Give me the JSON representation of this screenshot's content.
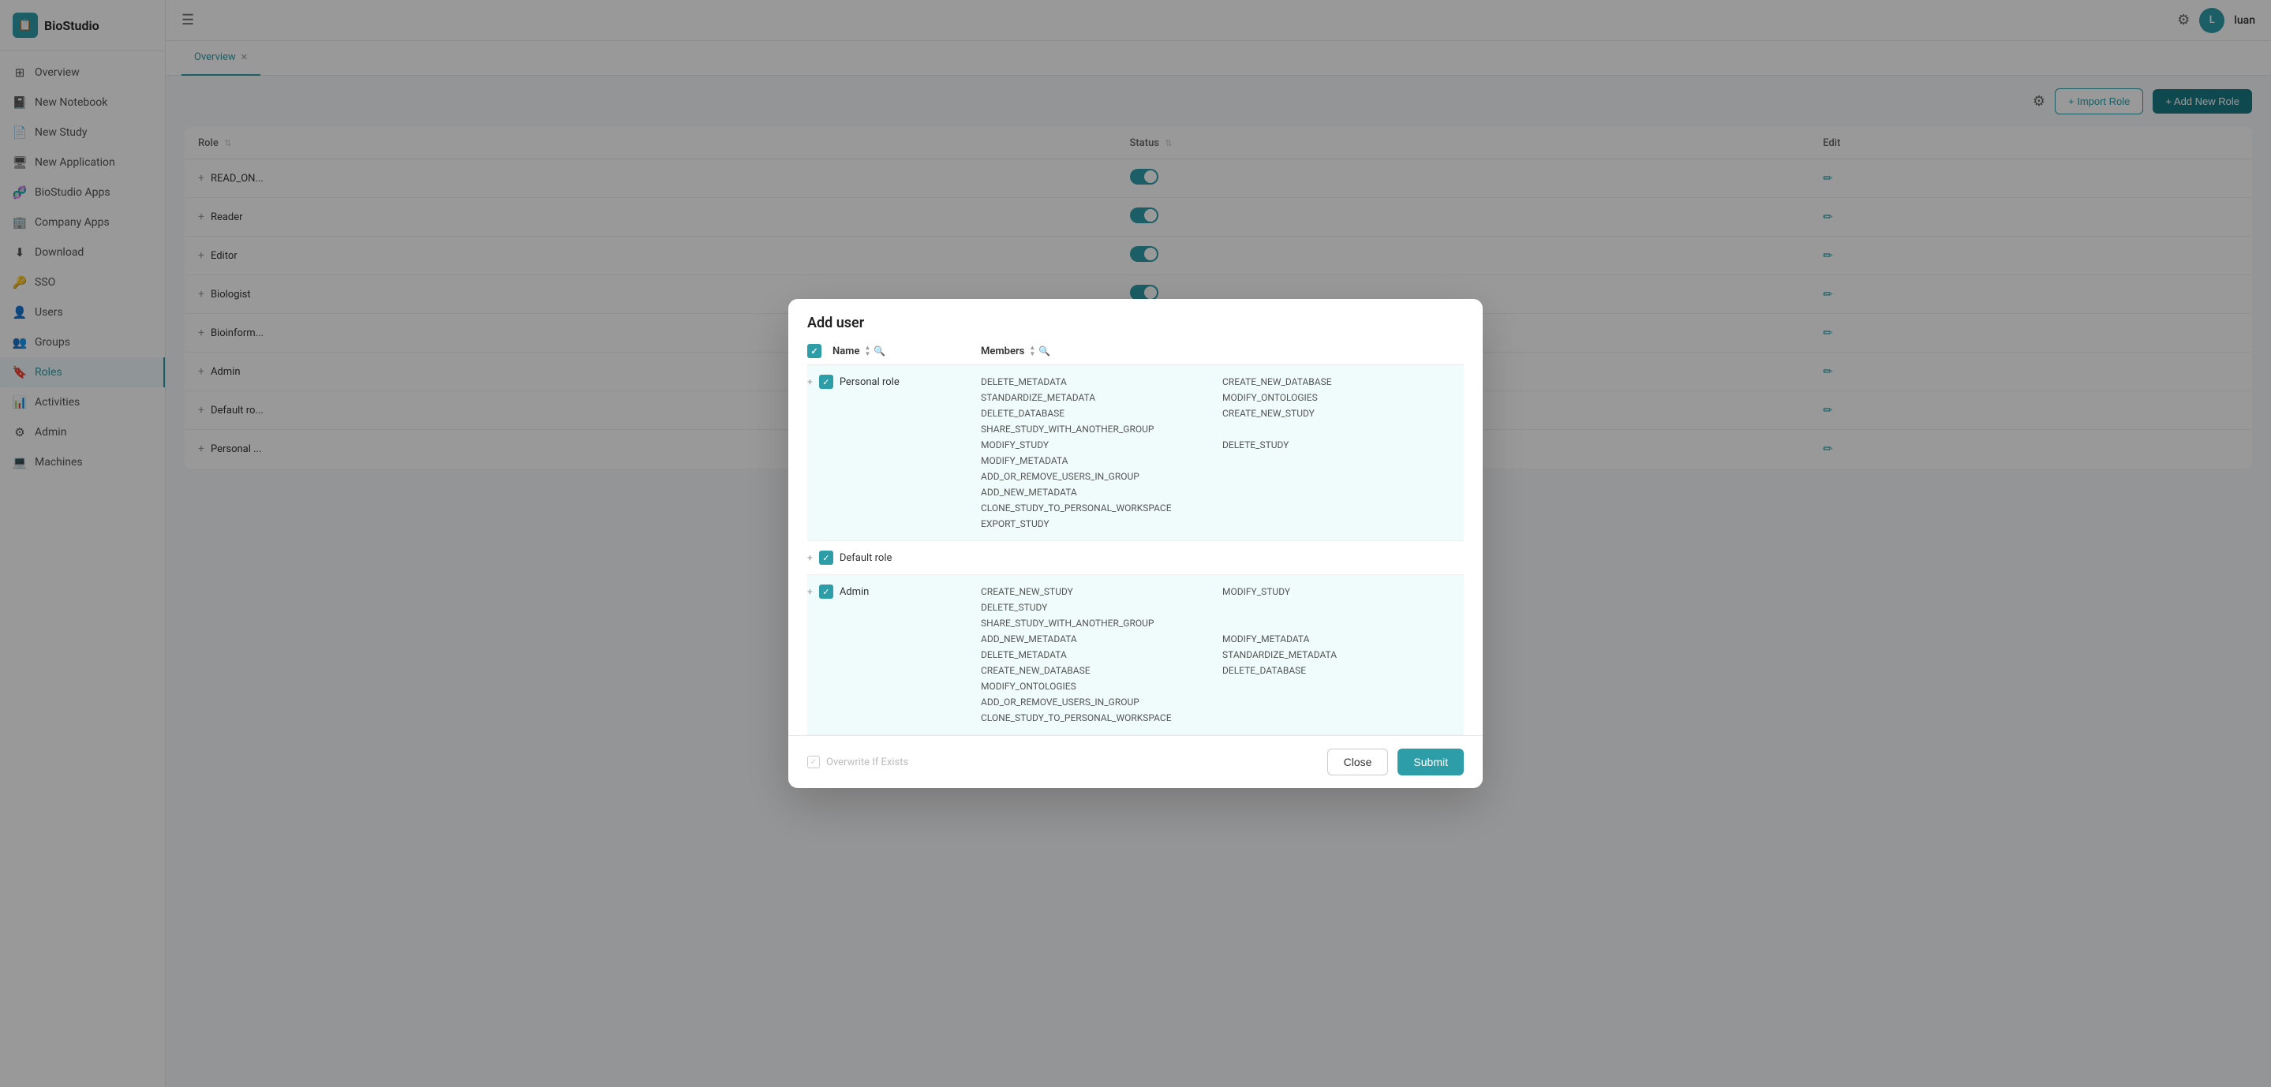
{
  "app": {
    "logo_text": "BioStudio",
    "logo_icon": "📋",
    "user_name": "luan",
    "user_initial": "L"
  },
  "sidebar": {
    "items": [
      {
        "id": "overview",
        "label": "Overview",
        "icon": "⊞",
        "active": false
      },
      {
        "id": "new-notebook",
        "label": "New Notebook",
        "icon": "📓",
        "active": false
      },
      {
        "id": "new-study",
        "label": "New Study",
        "icon": "📄",
        "active": false
      },
      {
        "id": "new-application",
        "label": "New Application",
        "icon": "🖥",
        "active": false
      },
      {
        "id": "biostudio-apps",
        "label": "BioStudio Apps",
        "icon": "🧬",
        "active": false
      },
      {
        "id": "company-apps",
        "label": "Company Apps",
        "icon": "🏢",
        "active": false
      },
      {
        "id": "download",
        "label": "Download",
        "icon": "⬇",
        "active": false
      },
      {
        "id": "sso",
        "label": "SSO",
        "icon": "🔑",
        "active": false
      },
      {
        "id": "users",
        "label": "Users",
        "icon": "👤",
        "active": false
      },
      {
        "id": "groups",
        "label": "Groups",
        "icon": "👥",
        "active": false
      },
      {
        "id": "roles",
        "label": "Roles",
        "icon": "🔖",
        "active": true
      },
      {
        "id": "activities",
        "label": "Activities",
        "icon": "📊",
        "active": false
      },
      {
        "id": "admin",
        "label": "Admin",
        "icon": "⚙",
        "active": false
      },
      {
        "id": "machines",
        "label": "Machines",
        "icon": "💻",
        "active": false
      }
    ]
  },
  "tabs": [
    {
      "id": "overview",
      "label": "Overview",
      "active": true
    }
  ],
  "toolbar": {
    "import_role_label": "+ Import Role",
    "add_new_role_label": "+ Add New Role"
  },
  "table": {
    "columns": [
      {
        "id": "role",
        "label": "Role"
      },
      {
        "id": "status",
        "label": "Status"
      },
      {
        "id": "edit",
        "label": "Edit"
      }
    ],
    "rows": [
      {
        "id": 1,
        "role": "READ_ON...",
        "status": true
      },
      {
        "id": 2,
        "role": "Reader",
        "status": true
      },
      {
        "id": 3,
        "role": "Editor",
        "status": true
      },
      {
        "id": 4,
        "role": "Biologist",
        "status": true
      },
      {
        "id": 5,
        "role": "Bioinform...",
        "status": true
      },
      {
        "id": 6,
        "role": "Admin",
        "status": true
      },
      {
        "id": 7,
        "role": "Default ro...",
        "status": true
      },
      {
        "id": 8,
        "role": "Personal ...",
        "status": true
      }
    ]
  },
  "modal": {
    "title": "Add user",
    "col_name": "Name",
    "col_members": "Members",
    "roles": [
      {
        "id": "personal",
        "label": "Personal role",
        "checked": true,
        "expanded": true,
        "permissions": [
          "DELETE_METADATA",
          "CREATE_NEW_DATABASE",
          "STANDARDIZE_METADATA",
          "MODIFY_ONTOLOGIES",
          "DELETE_DATABASE",
          "CREATE_NEW_STUDY",
          "SHARE_STUDY_WITH_ANOTHER_GROUP",
          "",
          "MODIFY_STUDY",
          "DELETE_STUDY",
          "MODIFY_METADATA",
          "",
          "ADD_OR_REMOVE_USERS_IN_GROUP",
          "",
          "ADD_NEW_METADATA",
          "",
          "CLONE_STUDY_TO_PERSONAL_WORKSPACE",
          "",
          "EXPORT_STUDY",
          ""
        ]
      },
      {
        "id": "default",
        "label": "Default role",
        "checked": true,
        "expanded": false,
        "permissions": []
      },
      {
        "id": "admin",
        "label": "Admin",
        "checked": true,
        "expanded": true,
        "permissions": [
          "CREATE_NEW_STUDY",
          "MODIFY_STUDY",
          "DELETE_STUDY",
          "",
          "SHARE_STUDY_WITH_ANOTHER_GROUP",
          "",
          "ADD_NEW_METADATA",
          "MODIFY_METADATA",
          "DELETE_METADATA",
          "STANDARDIZE_METADATA",
          "CREATE_NEW_DATABASE",
          "DELETE_DATABASE",
          "MODIFY_ONTOLOGIES",
          "",
          "ADD_OR_REMOVE_USERS_IN_GROUP",
          "",
          "CLONE_STUDY_TO_PERSONAL_WORKSPACE",
          ""
        ]
      }
    ],
    "overwrite_label": "Overwrite If Exists",
    "close_label": "Close",
    "submit_label": "Submit"
  }
}
